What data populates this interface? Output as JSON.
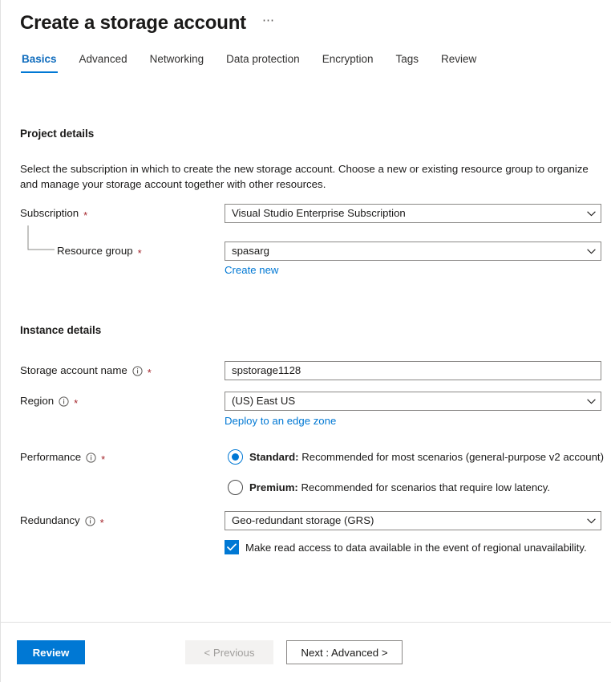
{
  "header": {
    "title": "Create a storage account",
    "more_label": "⋯"
  },
  "tabs": [
    {
      "label": "Basics",
      "active": true
    },
    {
      "label": "Advanced",
      "active": false
    },
    {
      "label": "Networking",
      "active": false
    },
    {
      "label": "Data protection",
      "active": false
    },
    {
      "label": "Encryption",
      "active": false
    },
    {
      "label": "Tags",
      "active": false
    },
    {
      "label": "Review",
      "active": false
    }
  ],
  "project_details": {
    "heading": "Project details",
    "description": "Select the subscription in which to create the new storage account. Choose a new or existing resource group to organize and manage your storage account together with other resources.",
    "subscription": {
      "label": "Subscription",
      "required_marker": "*",
      "value": "Visual Studio Enterprise Subscription"
    },
    "resource_group": {
      "label": "Resource group",
      "required_marker": "*",
      "value": "spasarg",
      "create_new_link": "Create new"
    }
  },
  "instance_details": {
    "heading": "Instance details",
    "storage_account_name": {
      "label": "Storage account name",
      "required_marker": "*",
      "value": "spstorage1128",
      "info_icon": "info-icon"
    },
    "region": {
      "label": "Region",
      "required_marker": "*",
      "value": "(US) East US",
      "info_icon": "info-icon",
      "edge_zone_link": "Deploy to an edge zone"
    },
    "performance": {
      "label": "Performance",
      "required_marker": "*",
      "info_icon": "info-icon",
      "options": [
        {
          "name": "Standard:",
          "description": " Recommended for most scenarios (general-purpose v2 account)",
          "selected": true
        },
        {
          "name": "Premium:",
          "description": " Recommended for scenarios that require low latency.",
          "selected": false
        }
      ]
    },
    "redundancy": {
      "label": "Redundancy",
      "required_marker": "*",
      "info_icon": "info-icon",
      "value": "Geo-redundant storage (GRS)",
      "checkbox_label": "Make read access to data available in the event of regional unavailability.",
      "checkbox_checked": true
    }
  },
  "footer": {
    "review_label": "Review",
    "previous_label": "< Previous",
    "next_label": "Next : Advanced >"
  },
  "colors": {
    "accent": "#0078d4",
    "link": "#0078d4",
    "required": "#a4262c",
    "border": "#8a8886",
    "disabled_bg": "#f3f2f1",
    "disabled_text": "#a19f9d"
  }
}
